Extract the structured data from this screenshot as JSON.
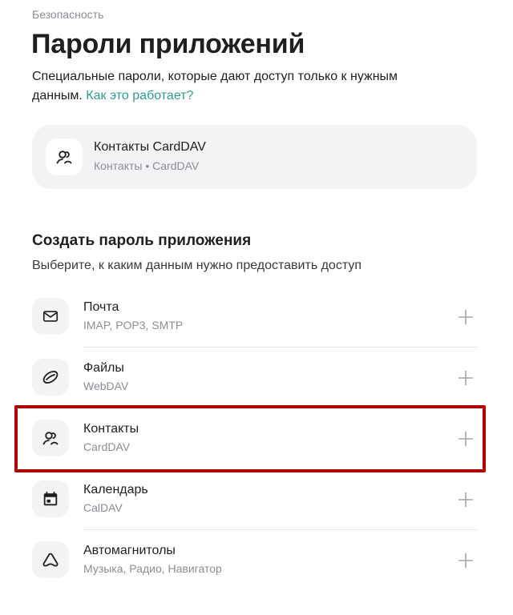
{
  "breadcrumb": "Безопасность",
  "title": "Пароли приложений",
  "description": {
    "text": "Специальные пароли, которые дают доступ только к нужным данным. ",
    "link": "Как это работает?"
  },
  "existing_password": {
    "icon": "contacts-icon",
    "title": "Контакты CardDAV",
    "subtitle": "Контакты • CardDAV"
  },
  "create": {
    "title": "Создать пароль приложения",
    "subtitle": "Выберите, к каким данным нужно предоставить доступ",
    "items": [
      {
        "title": "Почта",
        "subtitle": "IMAP, POP3, SMTP",
        "icon": "mail-icon"
      },
      {
        "title": "Файлы",
        "subtitle": "WebDAV",
        "icon": "disk-icon"
      },
      {
        "title": "Контакты",
        "subtitle": "CardDAV",
        "icon": "contacts-icon"
      },
      {
        "title": "Календарь",
        "subtitle": "CalDAV",
        "icon": "calendar-icon"
      },
      {
        "title": "Автомагнитолы",
        "subtitle": "Музыка, Радио, Навигатор",
        "icon": "car-icon"
      }
    ]
  },
  "colors": {
    "link": "#2e9b8f",
    "highlight": "#b40000",
    "card_bg": "#f3f3f6",
    "muted_text": "#8c8c95"
  }
}
